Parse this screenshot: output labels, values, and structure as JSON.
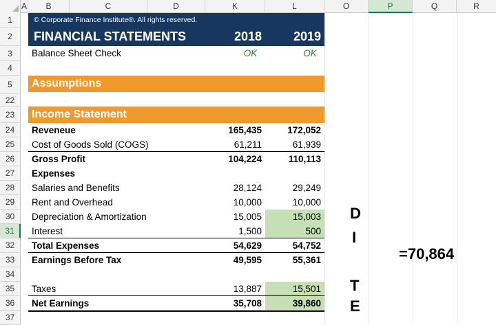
{
  "columns": [
    "A",
    "B",
    "C",
    "D",
    "K",
    "L",
    "O",
    "P",
    "Q",
    "R"
  ],
  "selected_column": "P",
  "rows": [
    "1",
    "2",
    "3",
    "4",
    "5",
    "22",
    "23",
    "24",
    "25",
    "26",
    "27",
    "28",
    "29",
    "30",
    "31",
    "32",
    "33",
    "34",
    "35",
    "36",
    "37"
  ],
  "selected_row": "31",
  "header": {
    "copyright": "© Corporate Finance Institute®. All rights reserved.",
    "title": "FINANCIAL STATEMENTS",
    "year_2018": "2018",
    "year_2019": "2019"
  },
  "balance_check": {
    "label": "Balance Sheet Check",
    "k": "OK",
    "l": "OK"
  },
  "sections": {
    "assumptions": "Assumptions",
    "income_statement": "Income Statement"
  },
  "lines": [
    {
      "label": "Reveneue",
      "k": "165,435",
      "l": "172,052"
    },
    {
      "label": "Cost of Goods Sold (COGS)",
      "k": "61,211",
      "l": "61,939"
    },
    {
      "label": "Gross Profit",
      "k": "104,224",
      "l": "110,113"
    },
    {
      "label": "Expenses",
      "k": "",
      "l": ""
    },
    {
      "label": "Salaries and Benefits",
      "k": "28,124",
      "l": "29,249"
    },
    {
      "label": "Rent and Overhead",
      "k": "10,000",
      "l": "10,000"
    },
    {
      "label": "Depreciation & Amortization",
      "k": "15,005",
      "l": "15,003"
    },
    {
      "label": "Interest",
      "k": "1,500",
      "l": "500"
    },
    {
      "label": "Total Expenses",
      "k": "54,629",
      "l": "54,752"
    },
    {
      "label": "Earnings Before Tax",
      "k": "49,595",
      "l": "55,361"
    },
    {
      "label": "",
      "k": "",
      "l": ""
    },
    {
      "label": "Taxes",
      "k": "13,887",
      "l": "15,501"
    },
    {
      "label": "Net Earnings",
      "k": "35,708",
      "l": "39,860"
    }
  ],
  "annotation_letters": [
    "D",
    "I",
    "T",
    "E"
  ],
  "formula": "=70,864",
  "colors": {
    "navy": "#17375e",
    "orange": "#f0992d",
    "green_fill": "#c5e0b4",
    "ok_green": "#2e7d32",
    "excel_green": "#217346"
  }
}
